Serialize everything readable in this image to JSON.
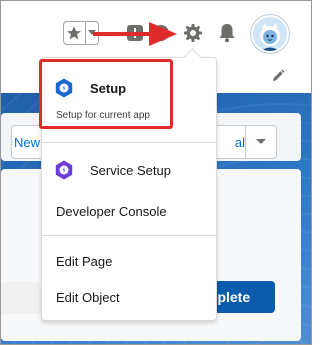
{
  "header": {
    "favorites_star": "★",
    "favorites_caret": "▾"
  },
  "tabs": {
    "tab_left_label": "New",
    "tab_right_label": "al"
  },
  "actions": {
    "complete_label": "mplete"
  },
  "menu": {
    "setup": {
      "title": "Setup",
      "subtitle": "Setup for current app"
    },
    "service_setup": {
      "title": "Service Setup"
    },
    "developer_console": {
      "label": "Developer Console"
    },
    "edit_page": {
      "label": "Edit Page"
    },
    "edit_object": {
      "label": "Edit Object"
    }
  },
  "colors": {
    "setup_icon": "#1b6ac9",
    "service_icon": "#6b3fd6",
    "highlight": "#e02b2b",
    "arrow": "#e02b2b",
    "brand_blue": "#0b5cad"
  },
  "icons": [
    "star-icon",
    "chevron-down-icon",
    "help-icon",
    "gear-icon",
    "bell-icon",
    "avatar",
    "pencil-icon",
    "red-arrow",
    "setup-gear-icon",
    "service-gear-icon"
  ]
}
